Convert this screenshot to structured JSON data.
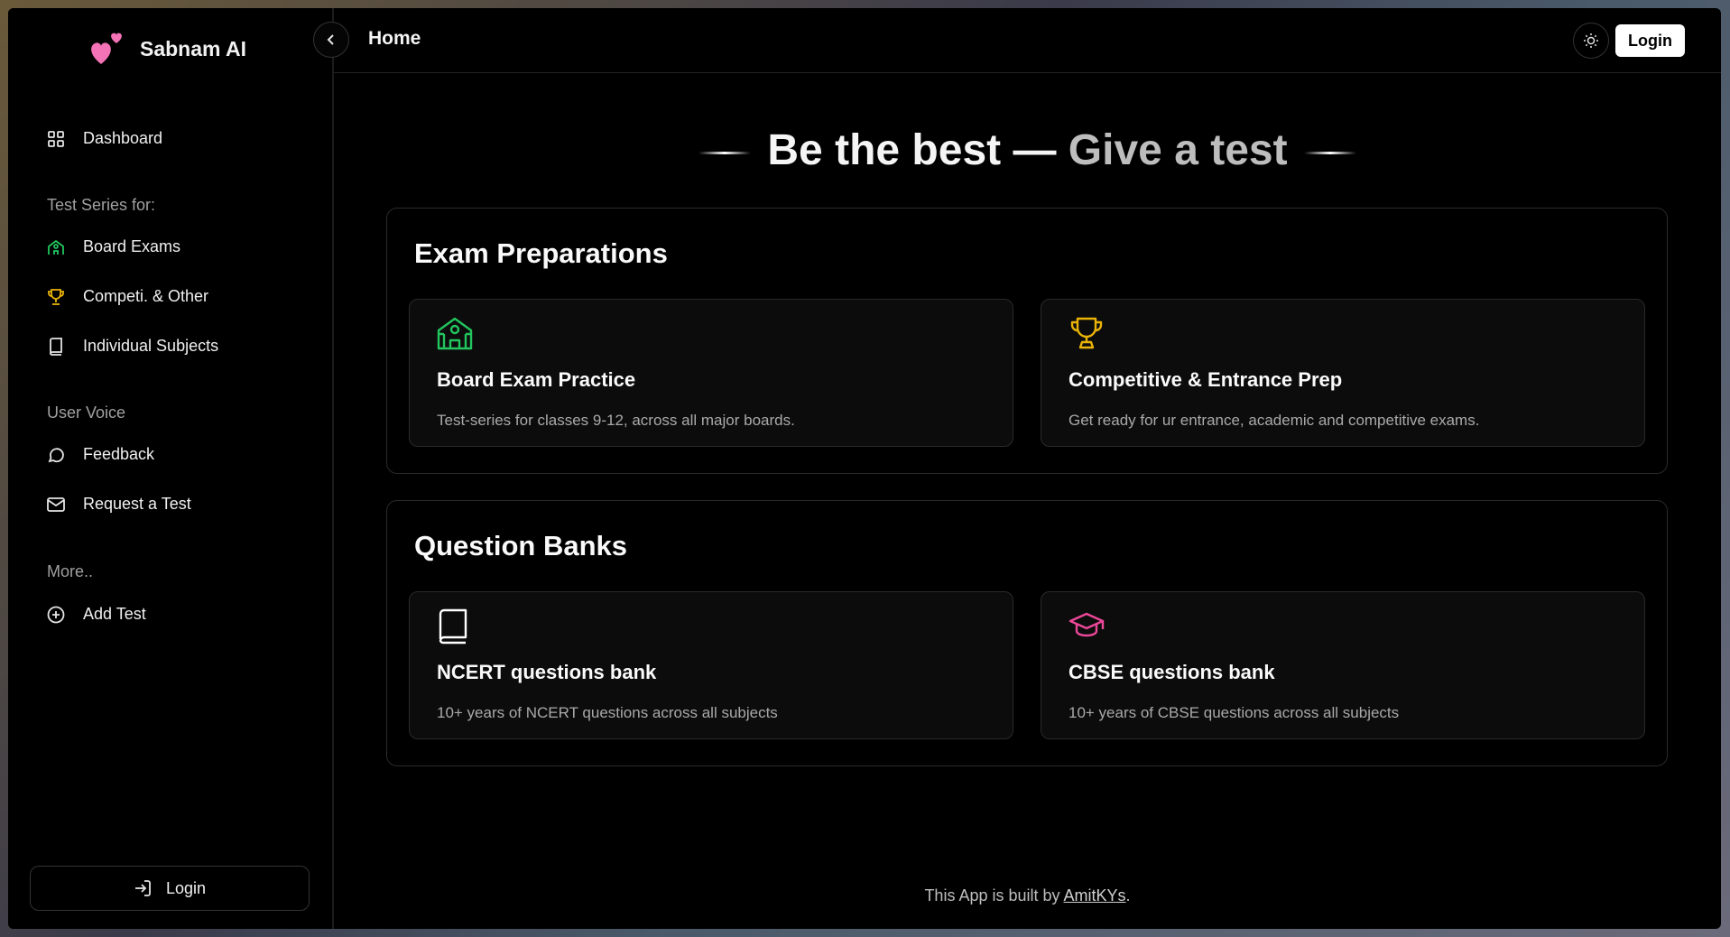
{
  "brand": {
    "name": "Sabnam AI",
    "heart_color": "#f472b6"
  },
  "sidebar": {
    "dashboard": "Dashboard",
    "section_test_series": "Test Series for:",
    "board_exams": "Board Exams",
    "competitive": "Competi. & Other",
    "individual_subjects": "Individual Subjects",
    "section_user_voice": "User Voice",
    "feedback": "Feedback",
    "request_test": "Request a Test",
    "section_more": "More..",
    "add_test": "Add Test",
    "login": "Login"
  },
  "header": {
    "title": "Home",
    "login": "Login"
  },
  "hero": {
    "part1": "Be the best — ",
    "part2": "Give a test"
  },
  "exam_preparations": {
    "title": "Exam Preparations",
    "cards": [
      {
        "title": "Board Exam Practice",
        "desc": "Test-series for classes 9-12, across all major boards.",
        "icon": "school-icon",
        "color": "#22c55e"
      },
      {
        "title": "Competitive & Entrance Prep",
        "desc": "Get ready for ur entrance, academic and competitive exams.",
        "icon": "trophy-icon",
        "color": "#eab308"
      }
    ]
  },
  "question_banks": {
    "title": "Question Banks",
    "cards": [
      {
        "title": "NCERT questions bank",
        "desc": "10+ years of NCERT questions across all subjects",
        "icon": "book-icon",
        "color": "#ffffff"
      },
      {
        "title": "CBSE questions bank",
        "desc": "10+ years of CBSE questions across all subjects",
        "icon": "graduation-cap-icon",
        "color": "#ec4899"
      }
    ]
  },
  "footer": {
    "prefix": "This App is built by ",
    "author": "AmitKYs",
    "suffix": "."
  }
}
